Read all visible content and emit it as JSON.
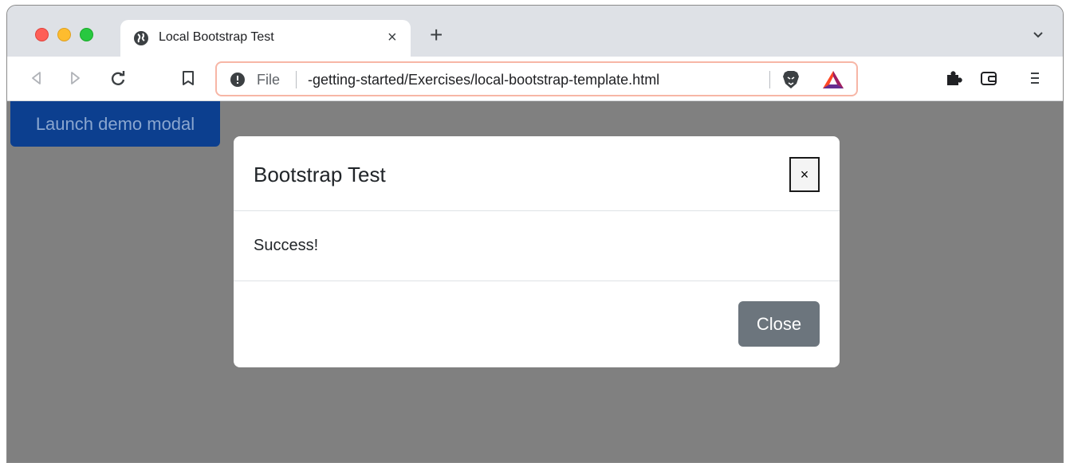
{
  "browser": {
    "tab": {
      "title": "Local Bootstrap Test",
      "close_glyph": "×"
    },
    "new_tab_glyph": "+",
    "address": {
      "scheme_label": "File",
      "url": "-getting-started/Exercises/local-bootstrap-template.html"
    },
    "icons": {
      "tab_favicon": "globe-icon",
      "tab_menu": "chevron-down-icon",
      "back": "back-icon",
      "forward": "forward-icon",
      "reload": "reload-icon",
      "bookmark": "bookmark-icon",
      "site_info": "info-icon",
      "shields": "brave-lion-icon",
      "rewards": "bat-triangle-icon",
      "extensions": "puzzle-icon",
      "wallet": "wallet-icon",
      "menu": "menu-icon"
    },
    "colors": {
      "omnibox_border": "#f7b6a6",
      "tabstrip": "#dee1e6"
    }
  },
  "page": {
    "launch_button": "Launch demo modal",
    "backdrop_color": "#808080",
    "modal": {
      "title": "Bootstrap Test",
      "close_x": "×",
      "body": "Success!",
      "close_button": "Close"
    }
  }
}
